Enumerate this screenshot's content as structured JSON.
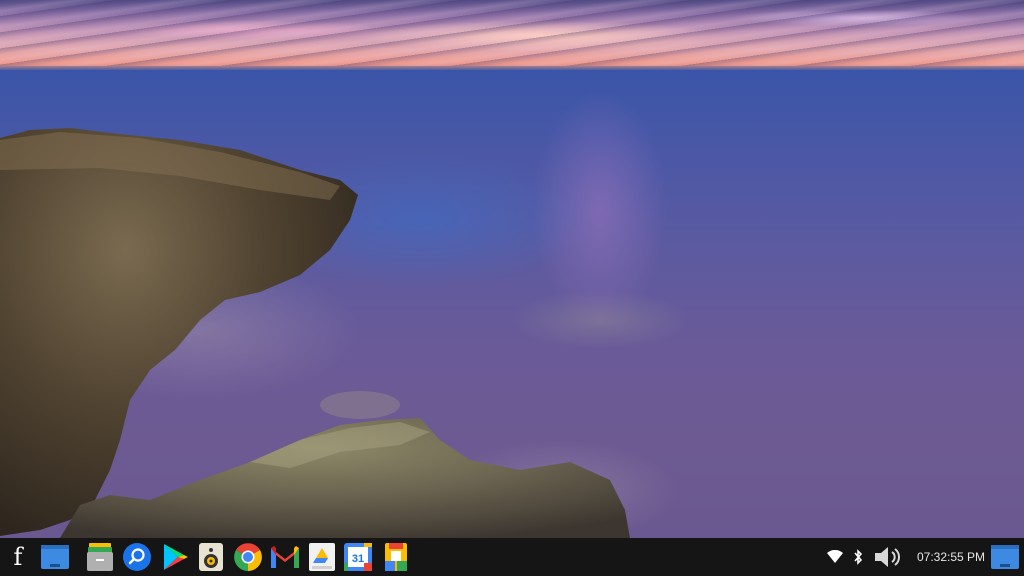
{
  "shelf": {
    "launcher_glyph": "f",
    "pinned_apps": [
      {
        "name": "window-app",
        "icon": "window-icon"
      },
      {
        "name": "files",
        "icon": "files-icon"
      },
      {
        "name": "search",
        "icon": "search-icon"
      },
      {
        "name": "play-store",
        "icon": "play-store-icon"
      },
      {
        "name": "speaker-app",
        "icon": "speaker-icon"
      },
      {
        "name": "chrome",
        "icon": "chrome-icon"
      },
      {
        "name": "gmail",
        "icon": "gmail-icon"
      },
      {
        "name": "google-drive",
        "icon": "drive-icon"
      },
      {
        "name": "google-calendar",
        "icon": "calendar-icon"
      },
      {
        "name": "google-docs",
        "icon": "docs-icon"
      }
    ],
    "calendar_day": "31",
    "tray": {
      "wifi_icon": "wifi-icon",
      "bluetooth_icon": "bluetooth-icon",
      "volume_icon": "volume-icon",
      "clock": "07:32:55 PM",
      "overview_icon": "window-icon"
    }
  },
  "colors": {
    "shelf_background": "#151515",
    "window_icon_blue": "#3d8ae2",
    "chrome_red": "#ea4335",
    "chrome_yellow": "#fbbc04",
    "chrome_green": "#34a853",
    "google_blue": "#4285f4"
  }
}
